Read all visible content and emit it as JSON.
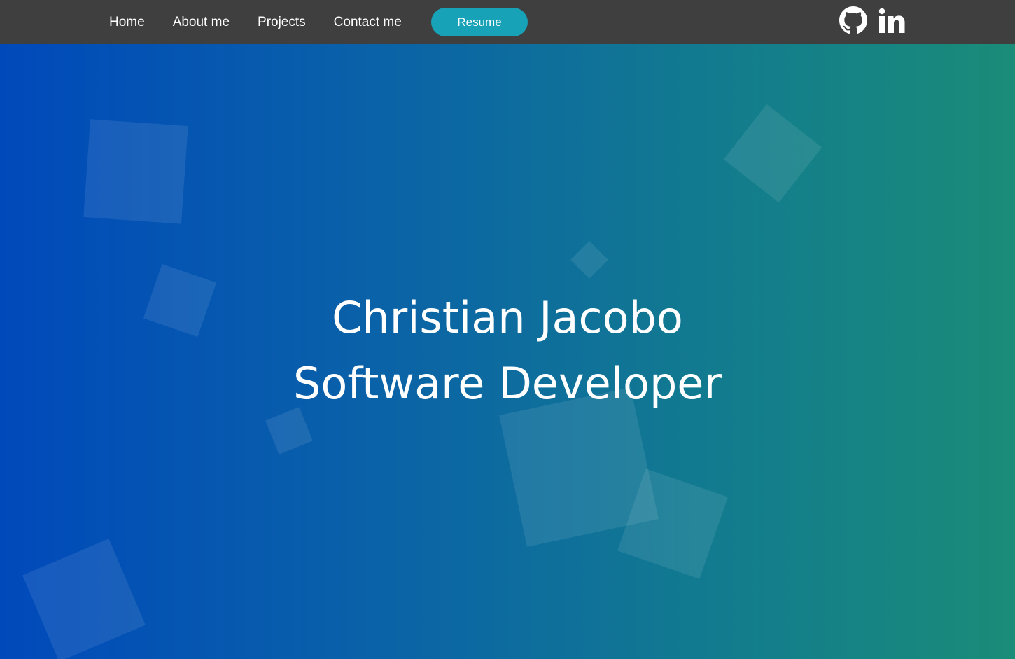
{
  "nav": {
    "links": [
      {
        "label": "Home"
      },
      {
        "label": "About me"
      },
      {
        "label": "Projects"
      },
      {
        "label": "Contact me"
      }
    ],
    "resume_label": "Resume",
    "social": {
      "github_icon": "github-icon",
      "linkedin_icon": "linkedin-icon"
    }
  },
  "hero": {
    "name": "Christian Jacobo",
    "title": "Software Developer"
  },
  "colors": {
    "navbar_bg": "#3f3f3f",
    "resume_button": "#17a2b8",
    "gradient_start": "#0049bb",
    "gradient_end": "#1a8c78"
  }
}
